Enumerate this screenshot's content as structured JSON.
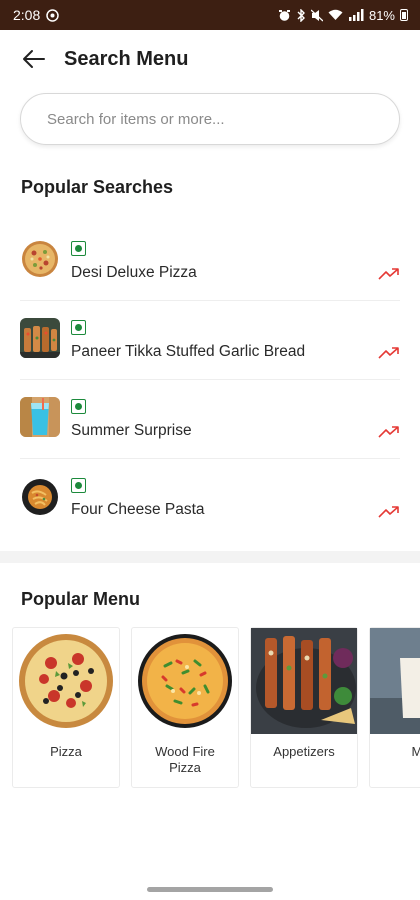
{
  "status_bar": {
    "time": "2:08",
    "battery": "81%"
  },
  "header": {
    "title": "Search Menu",
    "back_icon": "arrow-left-icon"
  },
  "search": {
    "placeholder": "Search for items or more..."
  },
  "popular_searches": {
    "title": "Popular Searches",
    "items": [
      {
        "name": "Desi Deluxe Pizza",
        "image": "pizza-thumbnail",
        "veg": true,
        "trend_icon": "trending-up-icon"
      },
      {
        "name": "Paneer Tikka Stuffed Garlic Bread",
        "image": "garlic-bread-thumbnail",
        "veg": true,
        "trend_icon": "trending-up-icon"
      },
      {
        "name": "Summer Surprise",
        "image": "drink-thumbnail",
        "veg": true,
        "trend_icon": "trending-up-icon"
      },
      {
        "name": "Four Cheese Pasta",
        "image": "pasta-thumbnail",
        "veg": true,
        "trend_icon": "trending-up-icon"
      }
    ]
  },
  "popular_menu": {
    "title": "Popular Menu",
    "items": [
      {
        "label": "Pizza",
        "image": "pizza-image"
      },
      {
        "label": "Wood Fire Pizza",
        "image": "wood-fire-pizza-image"
      },
      {
        "label": "Appetizers",
        "image": "appetizers-image"
      },
      {
        "label": "Milk",
        "image": "milkshake-image"
      }
    ]
  },
  "colors": {
    "status_bar_bg": "#3d1f12",
    "veg_green": "#1c8a3c",
    "trend_red": "#e53935"
  }
}
